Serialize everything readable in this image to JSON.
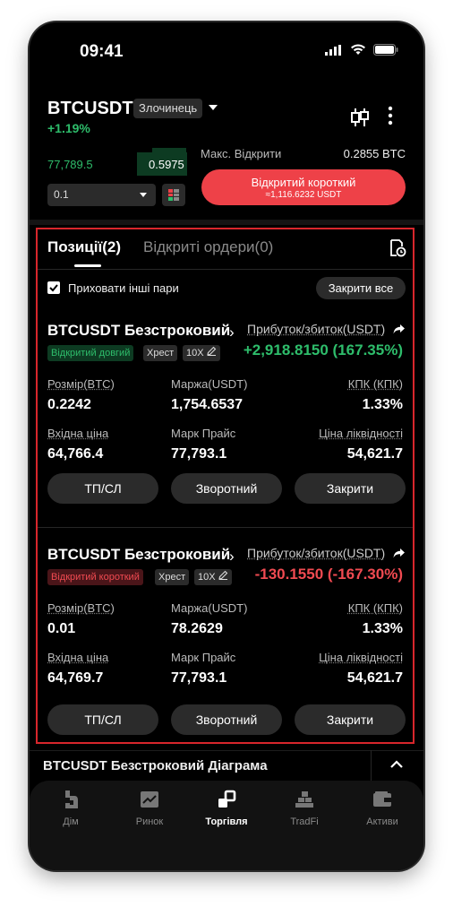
{
  "status_bar": {
    "time": "09:41"
  },
  "header": {
    "pair": "BTCUSDT",
    "tag": "Злочинець",
    "change": "+1.19%"
  },
  "order": {
    "last_price": "77,789.5",
    "depth_value": "0.5975",
    "max_open_label": "Макс. Відкрити",
    "max_open_value": "0.2855 BTC",
    "quantity": "0.1",
    "short_button_label": "Відкритий короткий",
    "short_button_sub": "≈1,116.6232 USDT"
  },
  "tabs": {
    "positions": "Позиції(2)",
    "open_orders": "Відкриті ордери(0)"
  },
  "filter": {
    "hide_other_pairs": "Приховати інші пари",
    "hide_checked": true,
    "close_all": "Закрити все"
  },
  "positions": [
    {
      "title": "BTCUSDT Безстроковий",
      "side_tag": "Відкритий довгий",
      "margin_mode": "Хрест",
      "leverage": "10X",
      "pnl_label": "Прибуток/збиток(USDT)",
      "pnl": "+2,918.8150 (167.35%)",
      "size_label": "Розмір(BTC)",
      "size": "0.2242",
      "margin_label": "Маржа(USDT)",
      "margin": "1,754.6537",
      "mmr_label": "КПК (КПК)",
      "mmr": "1.33%",
      "entry_label": "Вхідна ціна",
      "entry": "64,766.4",
      "mark_label": "Марк Прайс",
      "mark": "77,793.1",
      "liq_label": "Ціна ліквідності",
      "liq": "54,621.7",
      "btn_tpsl": "ТП/СЛ",
      "btn_reverse": "Зворотний",
      "btn_close": "Закрити"
    },
    {
      "title": "BTCUSDT Безстроковий",
      "side_tag": "Відкритий короткий",
      "margin_mode": "Хрест",
      "leverage": "10X",
      "pnl_label": "Прибуток/збиток(USDT)",
      "pnl": "-130.1550 (-167.30%)",
      "size_label": "Розмір(BTC)",
      "size": "0.01",
      "margin_label": "Маржа(USDT)",
      "margin": "78.2629",
      "mmr_label": "КПК (КПК)",
      "mmr": "1.33%",
      "entry_label": "Вхідна ціна",
      "entry": "64,769.7",
      "mark_label": "Марк Прайс",
      "mark": "77,793.1",
      "liq_label": "Ціна ліквідності",
      "liq": "54,621.7",
      "btn_tpsl": "ТП/СЛ",
      "btn_reverse": "Зворотний",
      "btn_close": "Закрити"
    }
  ],
  "chart_bar": {
    "label": "BTCUSDT Безстроковий Діаграма"
  },
  "bottom_nav": [
    {
      "label": "Дім",
      "icon": "home-icon"
    },
    {
      "label": "Ринок",
      "icon": "market-chart-icon"
    },
    {
      "label": "Торгівля",
      "icon": "trade-icon",
      "active": true
    },
    {
      "label": "TradFi",
      "icon": "tradfi-bars-icon"
    },
    {
      "label": "Активи",
      "icon": "wallet-icon"
    }
  ],
  "colors": {
    "up": "#2ebd6b",
    "down": "#f04a51",
    "short_button": "#ee4148",
    "highlight_frame": "#d8262c"
  }
}
